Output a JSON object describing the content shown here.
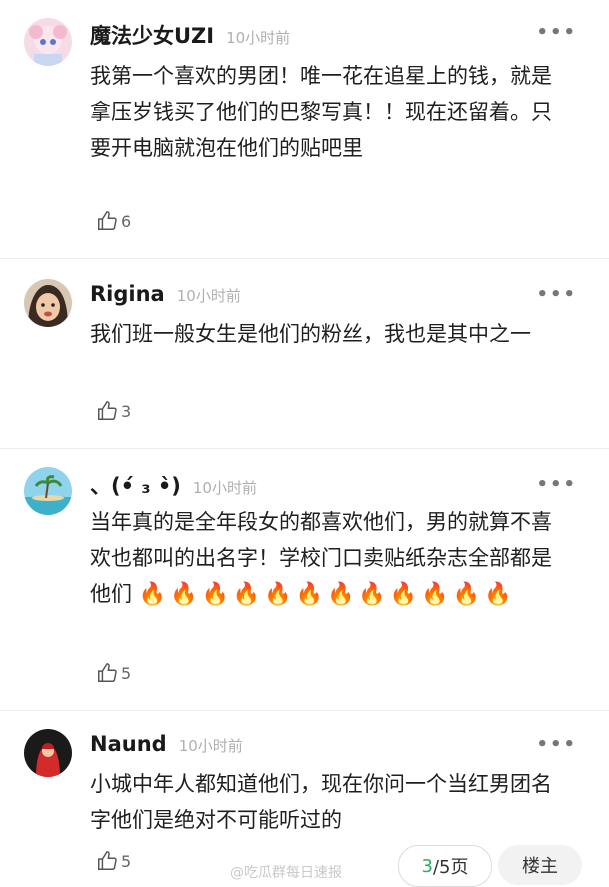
{
  "comments": [
    {
      "user": "魔法少女UZI",
      "time": "10小时前",
      "text": "我第一个喜欢的男团！唯一花在追星上的钱，就是拿压岁钱买了他们的巴黎写真！！现在还留着。只要开电脑就泡在他们的贴吧里",
      "likes": "6"
    },
    {
      "user": "Rigina",
      "time": "10小时前",
      "text": "我们班一般女生是他们的粉丝，我也是其中之一",
      "likes": "3"
    },
    {
      "user": "、(•́ ₃ •̀)",
      "time": "10小时前",
      "text": "当年真的是全年段女的都喜欢他们，男的就算不喜欢也都叫的出名字！学校门口卖贴纸杂志全部都是他们",
      "emoji": "🔥🔥🔥🔥🔥🔥🔥🔥🔥🔥🔥🔥",
      "likes": "5"
    },
    {
      "user": "Naund",
      "time": "10小时前",
      "text": "小城中年人都知道他们，现在你问一个当红男团名字他们是绝对不可能听过的",
      "likes": "5"
    }
  ],
  "more_label": "•••",
  "pager": {
    "current": "3",
    "total": "/5页"
  },
  "floor_button": "楼主",
  "watermark": "@吃瓜群每日速报"
}
